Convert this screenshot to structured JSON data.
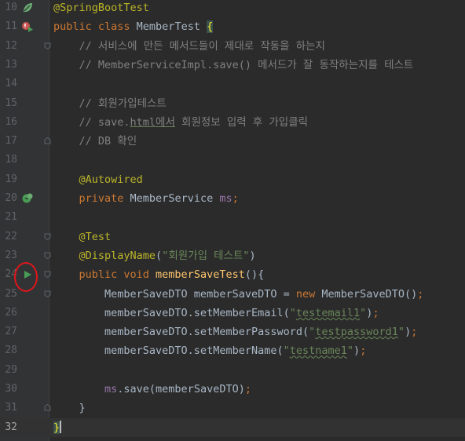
{
  "editor": {
    "lines": [
      {
        "n": "10",
        "segs": [
          [
            "annot",
            "@SpringBootTest"
          ]
        ]
      },
      {
        "n": "11",
        "segs": [
          [
            "kw",
            "public class "
          ],
          [
            "plain",
            "MemberTest "
          ],
          [
            "brace",
            "{"
          ]
        ]
      },
      {
        "n": "12",
        "segs": [
          [
            "cmt",
            "    // 서비스에 만든 메서드들이 제대로 작동을 하는지"
          ]
        ]
      },
      {
        "n": "13",
        "segs": [
          [
            "cmt",
            "    // MemberServiceImpl.save() 메서드가 잘 동작하는지를 테스트"
          ]
        ]
      },
      {
        "n": "14",
        "segs": []
      },
      {
        "n": "15",
        "segs": [
          [
            "cmt",
            "    // 회원가입테스트"
          ]
        ]
      },
      {
        "n": "16",
        "segs": [
          [
            "cmt",
            "    // save."
          ],
          [
            "cmtu",
            "html에서"
          ],
          [
            "cmt",
            " 회원정보 입력 후 가입클릭"
          ]
        ]
      },
      {
        "n": "17",
        "segs": [
          [
            "cmt",
            "    // DB 확인"
          ]
        ]
      },
      {
        "n": "18",
        "segs": []
      },
      {
        "n": "19",
        "segs": [
          [
            "annot",
            "    @Autowired"
          ]
        ]
      },
      {
        "n": "20",
        "segs": [
          [
            "kw",
            "    private "
          ],
          [
            "plain",
            "MemberService "
          ],
          [
            "fld",
            "ms"
          ],
          [
            "kw",
            ";"
          ]
        ]
      },
      {
        "n": "21",
        "segs": []
      },
      {
        "n": "22",
        "segs": [
          [
            "annot",
            "    @Test"
          ]
        ]
      },
      {
        "n": "23",
        "segs": [
          [
            "annot",
            "    @DisplayName"
          ],
          [
            "plain",
            "("
          ],
          [
            "str",
            "\"회원가입 테스트\""
          ],
          [
            "plain",
            ")"
          ]
        ]
      },
      {
        "n": "24",
        "segs": [
          [
            "kw",
            "    public void "
          ],
          [
            "fn",
            "memberSaveTest"
          ],
          [
            "plain",
            "(){"
          ]
        ]
      },
      {
        "n": "25",
        "segs": [
          [
            "plain",
            "        MemberSaveDTO memberSaveDTO = "
          ],
          [
            "kw",
            "new "
          ],
          [
            "plain",
            "MemberSaveDTO()"
          ],
          [
            "kw",
            ";"
          ]
        ]
      },
      {
        "n": "26",
        "segs": [
          [
            "plain",
            "        memberSaveDTO.setMemberEmail("
          ],
          [
            "str",
            "\""
          ],
          [
            "stru",
            "testemail1"
          ],
          [
            "str",
            "\""
          ],
          [
            "plain",
            ")"
          ],
          [
            "kw",
            ";"
          ]
        ]
      },
      {
        "n": "27",
        "segs": [
          [
            "plain",
            "        memberSaveDTO.setMemberPassword("
          ],
          [
            "str",
            "\""
          ],
          [
            "stru",
            "testpassword1"
          ],
          [
            "str",
            "\""
          ],
          [
            "plain",
            ")"
          ],
          [
            "kw",
            ";"
          ]
        ]
      },
      {
        "n": "28",
        "segs": [
          [
            "plain",
            "        memberSaveDTO.setMemberName("
          ],
          [
            "str",
            "\""
          ],
          [
            "stru",
            "testname1"
          ],
          [
            "str",
            "\""
          ],
          [
            "plain",
            ")"
          ],
          [
            "kw",
            ";"
          ]
        ]
      },
      {
        "n": "29",
        "segs": []
      },
      {
        "n": "30",
        "segs": [
          [
            "fld",
            "        ms"
          ],
          [
            "plain",
            ".save(memberSaveDTO)"
          ],
          [
            "kw",
            ";"
          ]
        ]
      },
      {
        "n": "31",
        "segs": [
          [
            "plain",
            "    }"
          ]
        ]
      },
      {
        "n": "32",
        "segs": [
          [
            "brace",
            "}"
          ],
          [
            "caret",
            ""
          ]
        ],
        "current": true
      }
    ]
  },
  "gutter_icons": {
    "10": "spring-bean-icon",
    "11": "run-test-class-icon",
    "20": "autowired-bean-icon",
    "24": "run-test-icon"
  },
  "fold_lines": [
    "12",
    "17",
    "22",
    "23",
    "24",
    "25",
    "31"
  ],
  "colors": {
    "background": "#2b2b2b",
    "keyword": "#cc7832",
    "annotation": "#bbb529",
    "string": "#6a8759",
    "comment": "#808080",
    "field": "#9876aa",
    "method": "#ffc66d",
    "highlight_circle": "#e0161b"
  }
}
